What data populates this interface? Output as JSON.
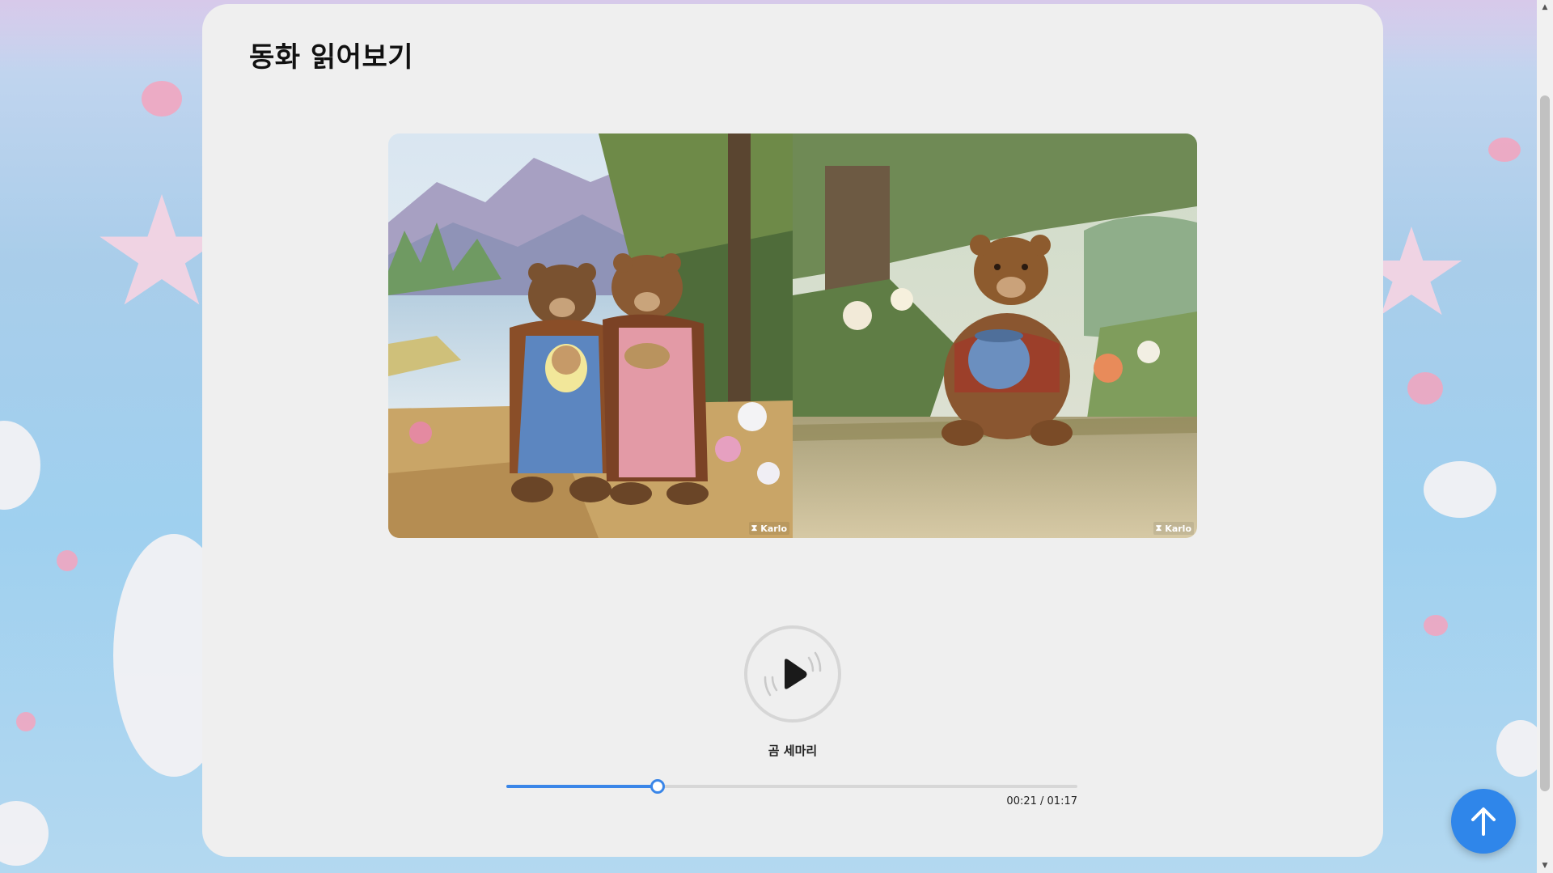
{
  "page": {
    "title": "동화 읽어보기"
  },
  "book": {
    "left_page": {
      "image": "illustration of a bear family with a baby bear by a mountain lake",
      "watermark": "Karlo"
    },
    "right_page": {
      "image": "illustration of a bear cub holding a honey pot by a pond",
      "watermark": "Karlo"
    }
  },
  "player": {
    "play_icon": "play-icon",
    "track_title": "곰 세마리",
    "progress_fraction": 0.265,
    "time_text": "00:21 / 01:17"
  },
  "scroll_top_button": {
    "icon": "arrow-up-icon"
  },
  "colors": {
    "accent": "#3a86e8",
    "card_background": "#efefef",
    "scroll_button": "#2f86ea"
  }
}
